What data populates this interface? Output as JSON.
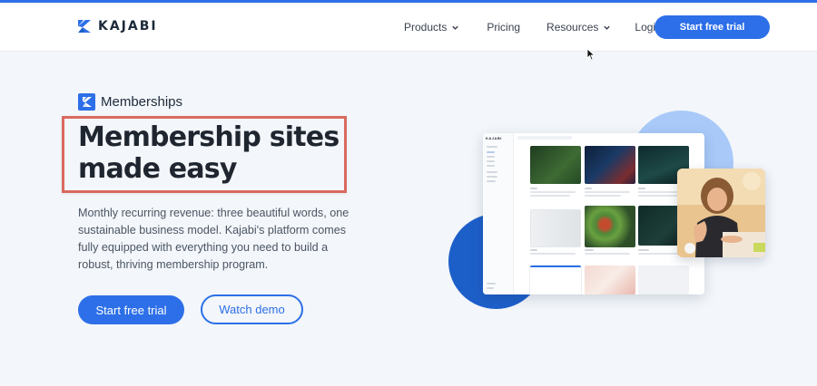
{
  "brand": {
    "name": "KAJABI"
  },
  "nav": {
    "products": "Products",
    "pricing": "Pricing",
    "resources": "Resources",
    "login": "Login",
    "cta": "Start free trial"
  },
  "hero": {
    "eyebrow": "Memberships",
    "headline_line1": "Membership sites",
    "headline_line2": "made easy",
    "description": "Monthly recurring revenue: three beautiful words, one sustainable business model. Kajabi's platform comes fully equipped with everything you need to build a robust, thriving membership program.",
    "primary_cta": "Start free trial",
    "secondary_cta": "Watch demo"
  },
  "mockup": {
    "app_logo": "KAJABI"
  },
  "colors": {
    "accent": "#2c6fe8",
    "highlight_border": "#d96a5f",
    "background": "#f3f6fa",
    "heading": "#1f2630"
  },
  "icons": {
    "products_chevron": "chevron-down-icon",
    "resources_chevron": "chevron-down-icon",
    "brand_mark": "kajabi-k-icon",
    "cursor": "mouse-pointer-icon"
  }
}
